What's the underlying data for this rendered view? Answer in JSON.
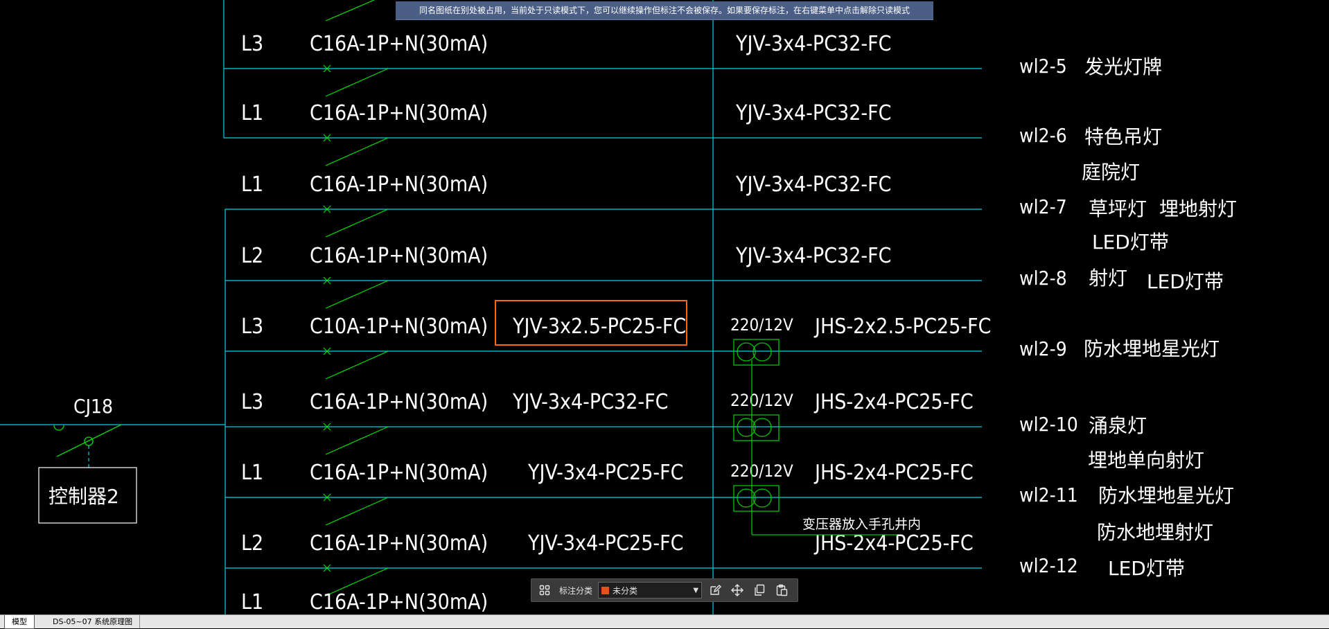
{
  "notice_banner": "同名图纸在别处被占用，当前处于只读模式下，您可以继续操作但标注不会被保存。如果要保存标注，在右键菜单中点击解除只读模式",
  "colors": {
    "background": "#000000",
    "bus_line": "#00d2e6",
    "switch_green": "#00e000",
    "transformer_green": "#00c800",
    "highlight_box": "#ff6a10",
    "text": "#ffffff",
    "banner_bg": "#4b5f86"
  },
  "drawing": {
    "circuits": [
      {
        "phase": "L3",
        "breaker": "C16A-1P+N(30mA)",
        "cable": "YJV-3x4-PC32-FC",
        "circuit_id": "wl2-5",
        "loads": [
          "发光灯牌"
        ]
      },
      {
        "phase": "L1",
        "breaker": "C16A-1P+N(30mA)",
        "cable": "YJV-3x4-PC32-FC",
        "circuit_id": "wl2-6",
        "loads": [
          "特色吊灯",
          "庭院灯"
        ]
      },
      {
        "phase": "L1",
        "breaker": "C16A-1P+N(30mA)",
        "cable": "YJV-3x4-PC32-FC",
        "circuit_id": "wl2-7",
        "loads": [
          "草坪灯",
          "埋地射灯",
          "LED灯带"
        ]
      },
      {
        "phase": "L2",
        "breaker": "C16A-1P+N(30mA)",
        "cable": "YJV-3x4-PC32-FC",
        "circuit_id": "wl2-8",
        "loads": [
          "射灯",
          "LED灯带"
        ]
      },
      {
        "phase": "L3",
        "breaker": "C10A-1P+N(30mA)",
        "cable": "YJV-3x2.5-PC25-FC",
        "transformer": "220/12V",
        "secondary_cable": "JHS-2x2.5-PC25-FC",
        "circuit_id": "wl2-9",
        "loads": [
          "防水埋地星光灯"
        ]
      },
      {
        "phase": "L3",
        "breaker": "C16A-1P+N(30mA)",
        "cable": "YJV-3x4-PC32-FC",
        "transformer": "220/12V",
        "secondary_cable": "JHS-2x4-PC25-FC",
        "circuit_id": "wl2-10",
        "loads": [
          "涌泉灯",
          "埋地单向射灯"
        ]
      },
      {
        "phase": "L1",
        "breaker": "C16A-1P+N(30mA)",
        "cable": "YJV-3x4-PC25-FC",
        "transformer": "220/12V",
        "secondary_cable": "JHS-2x4-PC25-FC",
        "circuit_id": "wl2-11",
        "loads": [
          "防水埋地星光灯",
          "防水地埋射灯"
        ]
      },
      {
        "phase": "L2",
        "breaker": "C16A-1P+N(30mA)",
        "cable": "YJV-3x4-PC25-FC",
        "secondary_cable": "JHS-2x4-PC25-FC",
        "circuit_id": "wl2-12",
        "loads": [
          "LED灯带"
        ]
      },
      {
        "phase": "L1",
        "breaker": "C16A-1P+N(30mA)"
      }
    ],
    "contactor_label": "CJ18",
    "controller_label": "控制器2",
    "transformer_note": "变压器放入手孔井内"
  },
  "annotation_toolbar": {
    "label": "标注分类",
    "category_value": "未分类",
    "category_color": "#e8501a",
    "icons": [
      "grid-icon",
      "edit-icon",
      "move-icon",
      "copy-icon",
      "paste-icon"
    ]
  },
  "layout_tabs": [
    {
      "label": "模型",
      "active": true
    },
    {
      "label": "DS-05~07 系统原理图",
      "active": false
    }
  ]
}
